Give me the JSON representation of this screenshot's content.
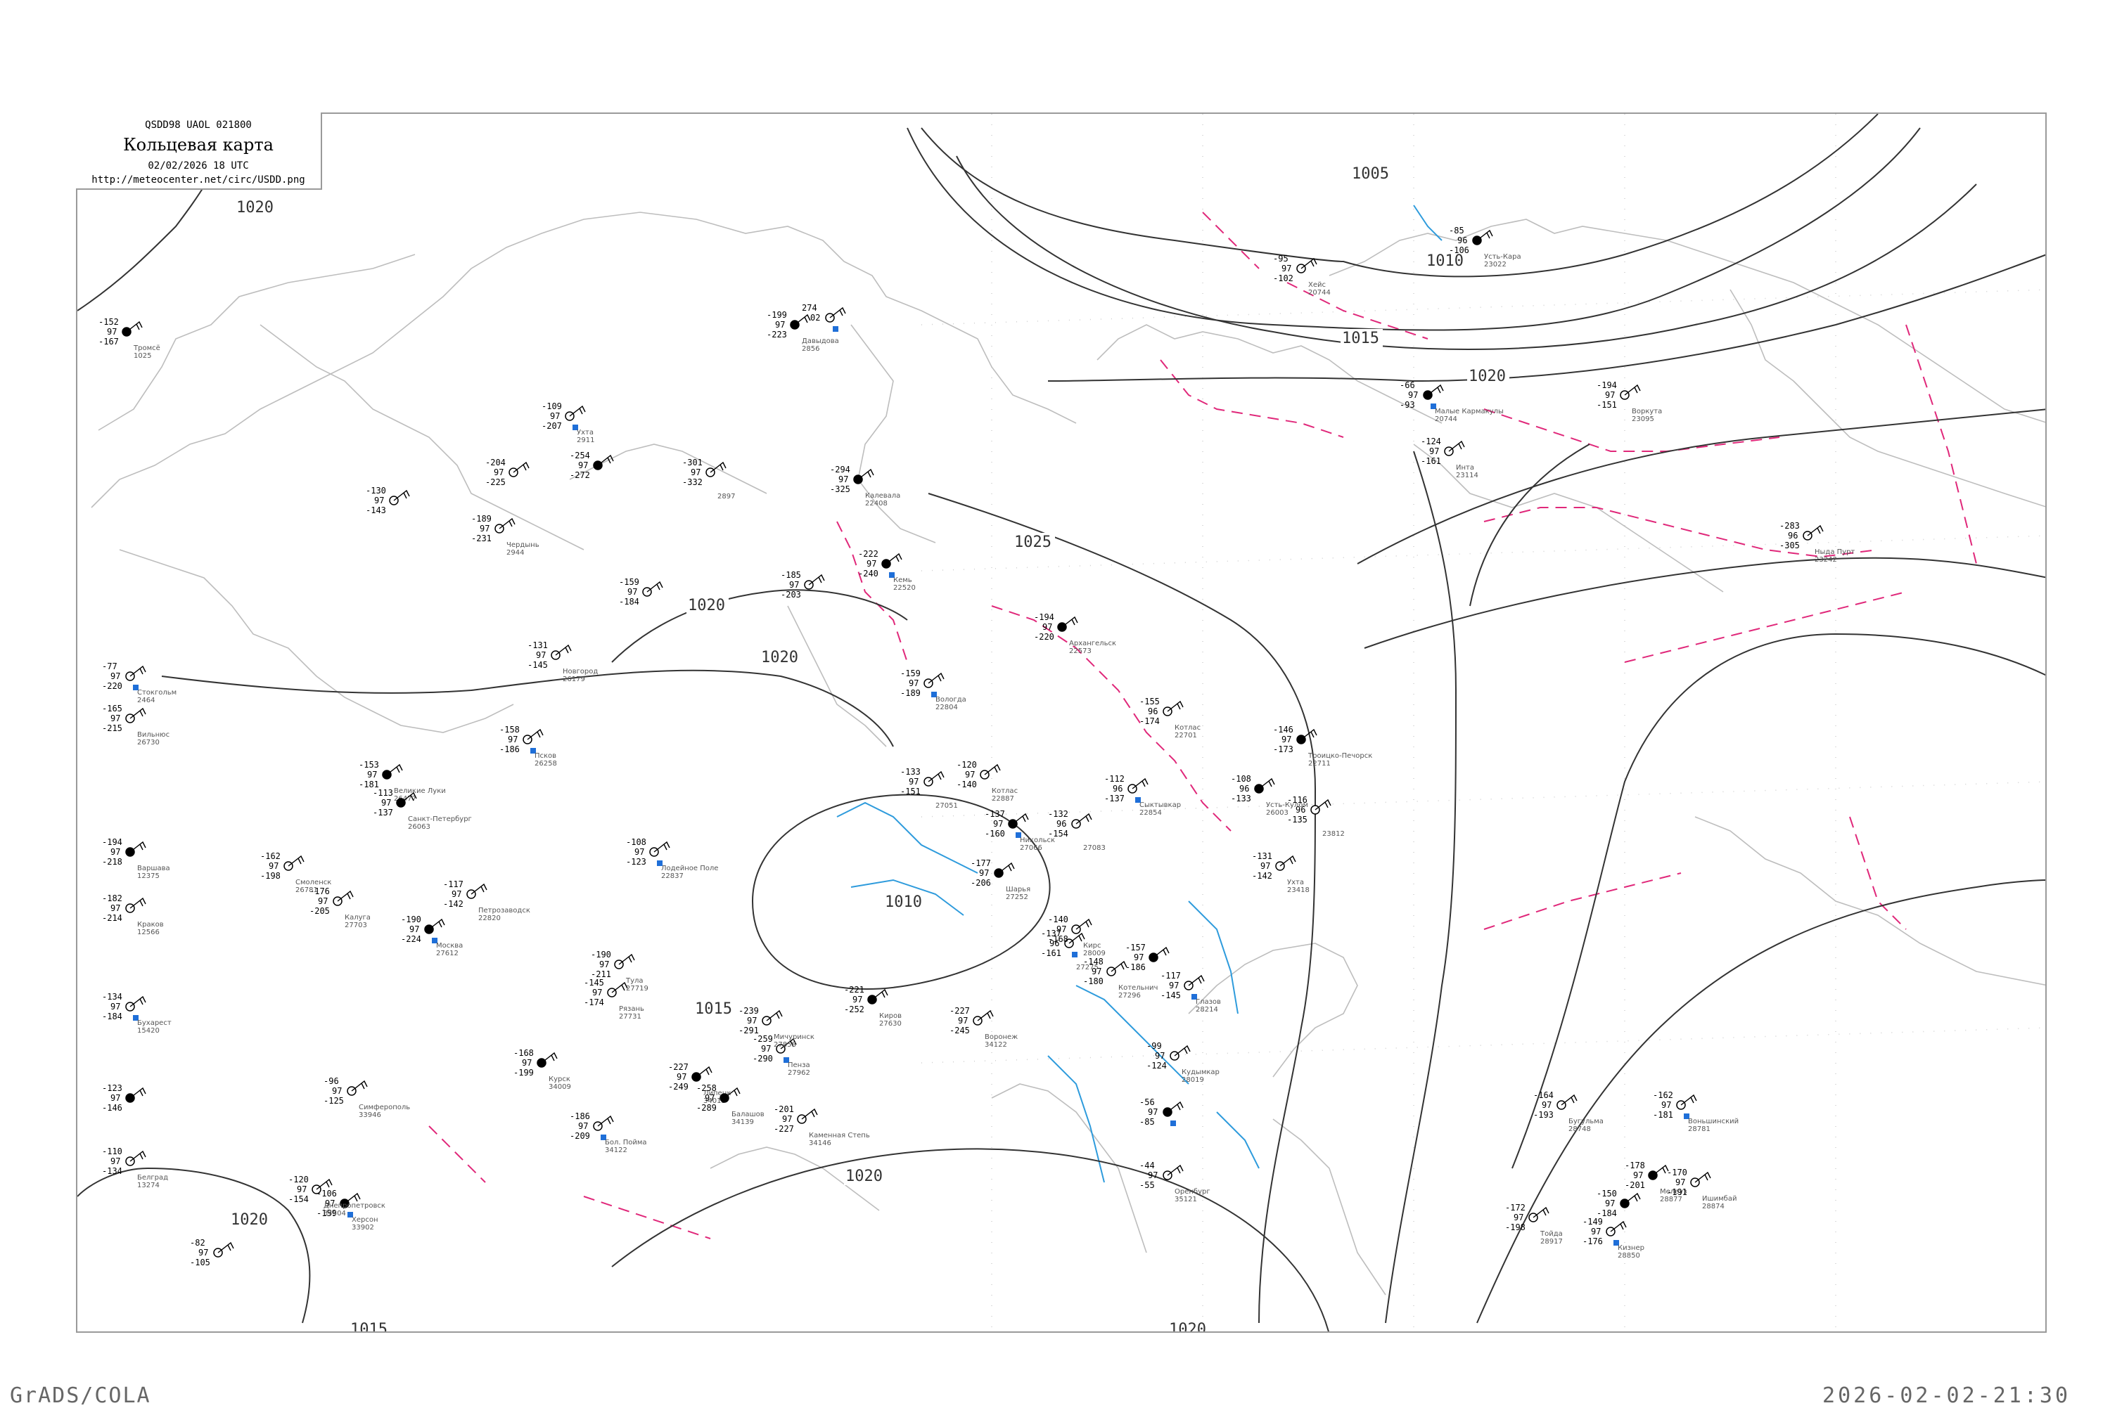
{
  "header": {
    "code": "QSDD98  UAOL  021800",
    "title": "Кольцевая карта",
    "date": "02/02/2026 18 UTC",
    "url": "http://meteocenter.net/circ/USDD.png"
  },
  "footer": {
    "left": "GrADS/COLA",
    "right": "2026-02-02-21:30"
  },
  "colors": {
    "isobar": "#333333",
    "coast": "#bdbdbd",
    "isotherm_minus": "#e0287a",
    "isotherm_plus": "#2e9bdc",
    "station_flag": "#1f6fd8"
  },
  "isobars": [
    {
      "label": "1005"
    },
    {
      "label": "1010"
    },
    {
      "label": "1015"
    },
    {
      "label": "1020"
    },
    {
      "label": "1025"
    },
    {
      "label": "1020"
    },
    {
      "label": "1015"
    },
    {
      "label": "1010"
    },
    {
      "label": "1015"
    },
    {
      "label": "1020"
    },
    {
      "label": "1020"
    },
    {
      "label": "1020"
    },
    {
      "label": "1020"
    },
    {
      "label": "1015"
    },
    {
      "label": "1020"
    },
    {
      "label": "1010"
    },
    {
      "label": "1020"
    }
  ],
  "stations": [
    {
      "t": "-199",
      "p": "97",
      "d": "-223",
      "name": "Давыдова",
      "id": "2856"
    },
    {
      "t": "274",
      "p": "02",
      "d": "",
      "name": "",
      "id": ""
    },
    {
      "t": "-301",
      "p": "97",
      "d": "-332",
      "name": "",
      "id": "2897"
    },
    {
      "t": "-294",
      "p": "97",
      "d": "-325",
      "name": "Калевала",
      "id": "22408"
    },
    {
      "t": "-204",
      "p": "97",
      "d": "-225",
      "name": "",
      "id": ""
    },
    {
      "t": "-109",
      "p": "97",
      "d": "-207",
      "name": "Ухта",
      "id": "2911"
    },
    {
      "t": "-254",
      "p": "97",
      "d": "-272",
      "name": "",
      "id": ""
    },
    {
      "t": "-130",
      "p": "97",
      "d": "-143",
      "name": "",
      "id": ""
    },
    {
      "t": "-189",
      "p": "97",
      "d": "-231",
      "name": "Чердынь",
      "id": "2944"
    },
    {
      "t": "-222",
      "p": "97",
      "d": "-240",
      "name": "Кемь",
      "id": "22520"
    },
    {
      "t": "-185",
      "p": "97",
      "d": "-203",
      "name": "",
      "id": ""
    },
    {
      "t": "-159",
      "p": "97",
      "d": "-184",
      "name": "",
      "id": ""
    },
    {
      "t": "-194",
      "p": "97",
      "d": "-220",
      "name": "Архангельск",
      "id": "22573"
    },
    {
      "t": "-159",
      "p": "97",
      "d": "-189",
      "name": "Вологда",
      "id": "22804"
    },
    {
      "t": "-155",
      "p": "96",
      "d": "-174",
      "name": "Котлас",
      "id": "22701"
    },
    {
      "t": "-146",
      "p": "97",
      "d": "-173",
      "name": "Троицко-Печорск",
      "id": "22711"
    },
    {
      "t": "-120",
      "p": "97",
      "d": "-140",
      "name": "Котлас",
      "id": "22887"
    },
    {
      "t": "-112",
      "p": "96",
      "d": "-137",
      "name": "Сыктывкар",
      "id": "22854"
    },
    {
      "t": "-108",
      "p": "96",
      "d": "-133",
      "name": "Усть-Кулом",
      "id": "26003"
    },
    {
      "t": "-116",
      "p": "96",
      "d": "-135",
      "name": "",
      "id": "23812"
    },
    {
      "t": "-133",
      "p": "97",
      "d": "-151",
      "name": "",
      "id": "27051"
    },
    {
      "t": "-137",
      "p": "97",
      "d": "-160",
      "name": "Никольск",
      "id": "27066"
    },
    {
      "t": "-132",
      "p": "96",
      "d": "-154",
      "name": "",
      "id": "27083"
    },
    {
      "t": "-131",
      "p": "97",
      "d": "-142",
      "name": "Ухта",
      "id": "23418"
    },
    {
      "t": "-177",
      "p": "97",
      "d": "-206",
      "name": "Шарья",
      "id": "27252"
    },
    {
      "t": "-137",
      "p": "96",
      "d": "-161",
      "name": "",
      "id": "27275"
    },
    {
      "t": "-140",
      "p": "97",
      "d": "-168",
      "name": "Кирс",
      "id": "28009"
    },
    {
      "t": "-157",
      "p": "97",
      "d": "-186",
      "name": "",
      "id": ""
    },
    {
      "t": "-148",
      "p": "97",
      "d": "-180",
      "name": "Котельнич",
      "id": "27296"
    },
    {
      "t": "-117",
      "p": "97",
      "d": "-145",
      "name": "Глазов",
      "id": "28214"
    },
    {
      "t": "-221",
      "p": "97",
      "d": "-252",
      "name": "Киров",
      "id": "27630"
    },
    {
      "t": "-227",
      "p": "97",
      "d": "-245",
      "name": "Воронеж",
      "id": "34122"
    },
    {
      "t": "-99",
      "p": "97",
      "d": "-124",
      "name": "Кудымкар",
      "id": "28019"
    },
    {
      "t": "-56",
      "p": "97",
      "d": "-85",
      "name": "",
      "id": ""
    },
    {
      "t": "-44",
      "p": "97",
      "d": "-55",
      "name": "Оренбург",
      "id": "35121"
    },
    {
      "t": "-164",
      "p": "97",
      "d": "-193",
      "name": "Бугульма",
      "id": "28748"
    },
    {
      "t": "-150",
      "p": "97",
      "d": "-184",
      "name": "",
      "id": ""
    },
    {
      "t": "-162",
      "p": "97",
      "d": "-181",
      "name": "Воньшинский",
      "id": "28781"
    },
    {
      "t": "-172",
      "p": "97",
      "d": "-198",
      "name": "Тойда",
      "id": "28917"
    },
    {
      "t": "-178",
      "p": "97",
      "d": "-201",
      "name": "Мелеуз",
      "id": "28877"
    },
    {
      "t": "-170",
      "p": "97",
      "d": "-191",
      "name": "Ишимбай",
      "id": "28874"
    },
    {
      "t": "-149",
      "p": "97",
      "d": "-176",
      "name": "Кизнер",
      "id": "28850"
    },
    {
      "t": "-85",
      "p": "96",
      "d": "-106",
      "name": "Усть-Кара",
      "id": "23022"
    },
    {
      "t": "-95",
      "p": "97",
      "d": "-102",
      "name": "Хейс",
      "id": "20744"
    },
    {
      "t": "-194",
      "p": "97",
      "d": "-151",
      "name": "Воркута",
      "id": "23095"
    },
    {
      "t": "-66",
      "p": "97",
      "d": "-93",
      "name": "Малые Кармакулы",
      "id": "20744"
    },
    {
      "t": "-124",
      "p": "97",
      "d": "-161",
      "name": "Инта",
      "id": "23114"
    },
    {
      "t": "-283",
      "p": "96",
      "d": "-305",
      "name": "Ныда Пурт",
      "id": "23242"
    },
    {
      "t": "-152",
      "p": "97",
      "d": "-167",
      "name": "Тромсё",
      "id": "1025"
    },
    {
      "t": "-77",
      "p": "97",
      "d": "-220",
      "name": "Стокгольм",
      "id": "2464"
    },
    {
      "t": "-165",
      "p": "97",
      "d": "-215",
      "name": "Вильнюс",
      "id": "26730"
    },
    {
      "t": "-194",
      "p": "97",
      "d": "-218",
      "name": "Варшава",
      "id": "12375"
    },
    {
      "t": "-182",
      "p": "97",
      "d": "-214",
      "name": "Краков",
      "id": "12566"
    },
    {
      "t": "-134",
      "p": "97",
      "d": "-184",
      "name": "Бухарест",
      "id": "15420"
    },
    {
      "t": "-123",
      "p": "97",
      "d": "-146",
      "name": "",
      "id": ""
    },
    {
      "t": "-110",
      "p": "97",
      "d": "-134",
      "name": "Белград",
      "id": "13274"
    },
    {
      "t": "-82",
      "p": "97",
      "d": "-105",
      "name": "",
      "id": ""
    },
    {
      "t": "-106",
      "p": "97",
      "d": "-159",
      "name": "Херсон",
      "id": "33902"
    },
    {
      "t": "-120",
      "p": "97",
      "d": "-154",
      "name": "Днепропетровск",
      "id": "34504"
    },
    {
      "t": "-96",
      "p": "97",
      "d": "-125",
      "name": "Симферополь",
      "id": "33946"
    },
    {
      "t": "-227",
      "p": "97",
      "d": "-249",
      "name": "Липецк",
      "id": "34013"
    },
    {
      "t": "-259",
      "p": "97",
      "d": "-290",
      "name": "Пенза",
      "id": "27962"
    },
    {
      "t": "-239",
      "p": "97",
      "d": "-291",
      "name": "Мичуринск",
      "id": "27858"
    },
    {
      "t": "-258",
      "p": "97",
      "d": "-289",
      "name": "Балашов",
      "id": "34139"
    },
    {
      "t": "-201",
      "p": "97",
      "d": "-227",
      "name": "Каменная Степь",
      "id": "34146"
    },
    {
      "t": "-186",
      "p": "97",
      "d": "-209",
      "name": "Бол. Пойма",
      "id": "34122"
    },
    {
      "t": "-168",
      "p": "97",
      "d": "-199",
      "name": "Курск",
      "id": "34009"
    },
    {
      "t": "-145",
      "p": "97",
      "d": "-174",
      "name": "Рязань",
      "id": "27731"
    },
    {
      "t": "-190",
      "p": "97",
      "d": "-211",
      "name": "Тула",
      "id": "27719"
    },
    {
      "t": "-190",
      "p": "97",
      "d": "-224",
      "name": "Москва",
      "id": "27612"
    },
    {
      "t": "-176",
      "p": "97",
      "d": "-205",
      "name": "Калуга",
      "id": "27703"
    },
    {
      "t": "-162",
      "p": "97",
      "d": "-198",
      "name": "Смоленск",
      "id": "26781"
    },
    {
      "t": "-153",
      "p": "97",
      "d": "-181",
      "name": "Великие Луки",
      "id": "26477"
    },
    {
      "t": "-158",
      "p": "97",
      "d": "-186",
      "name": "Псков",
      "id": "26258"
    },
    {
      "t": "-131",
      "p": "97",
      "d": "-145",
      "name": "Новгород",
      "id": "26179"
    },
    {
      "t": "-113",
      "p": "97",
      "d": "-137",
      "name": "Санкт-Петербург",
      "id": "26063"
    },
    {
      "t": "-117",
      "p": "97",
      "d": "-142",
      "name": "Петрозаводск",
      "id": "22820"
    },
    {
      "t": "-108",
      "p": "97",
      "d": "-123",
      "name": "Лодейное Поле",
      "id": "22837"
    }
  ],
  "station_count_note": "selection of representative station plots"
}
